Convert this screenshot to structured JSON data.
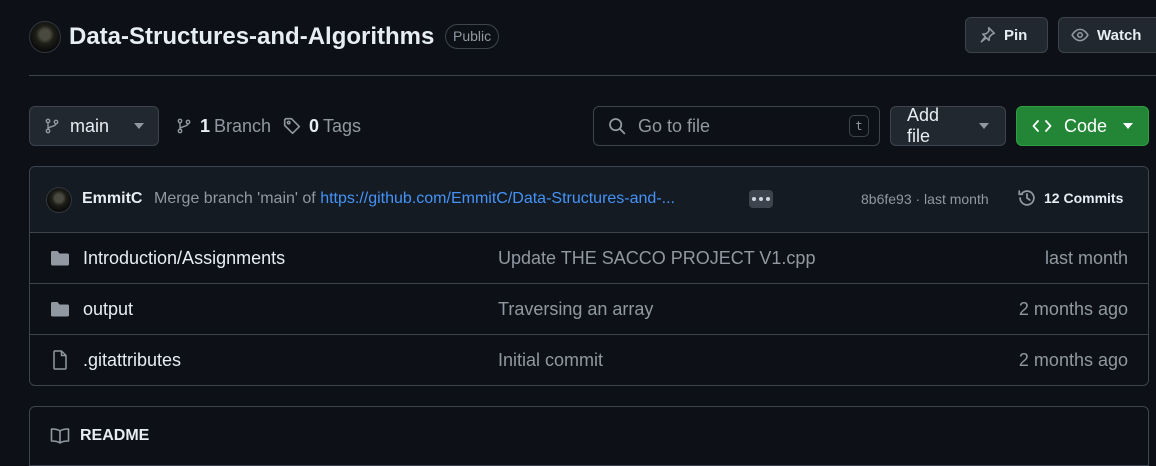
{
  "repo": {
    "name": "Data-Structures-and-Algorithms",
    "visibility": "Public",
    "pin_label": "Pin",
    "watch_label": "Watch"
  },
  "toolbar": {
    "branch": "main",
    "branch_count": "1",
    "branch_label": "Branch",
    "tag_count": "0",
    "tag_label": "Tags",
    "search_placeholder": "Go to file",
    "search_shortcut": "t",
    "add_file_label": "Add file",
    "code_label": "Code"
  },
  "commit": {
    "author": "EmmitC",
    "message_prefix": "Merge branch 'main' of",
    "message_link": "https://github.com/EmmitC/Data-Structures-and-...",
    "sha_time": "8b6fe93 · last month",
    "commits_label": "12 Commits"
  },
  "files": [
    {
      "name": "Introduction/Assignments",
      "type": "folder",
      "message": "Update THE SACCO PROJECT V1.cpp",
      "date": "last month"
    },
    {
      "name": "output",
      "type": "folder",
      "message": "Traversing an array",
      "date": "2 months ago"
    },
    {
      "name": ".gitattributes",
      "type": "file",
      "message": "Initial commit",
      "date": "2 months ago"
    }
  ],
  "readme": {
    "title": "README"
  },
  "colors": {
    "background": "#0d1117",
    "accent_green": "#238636",
    "link_blue": "#4493f8",
    "border": "#3d444d"
  }
}
